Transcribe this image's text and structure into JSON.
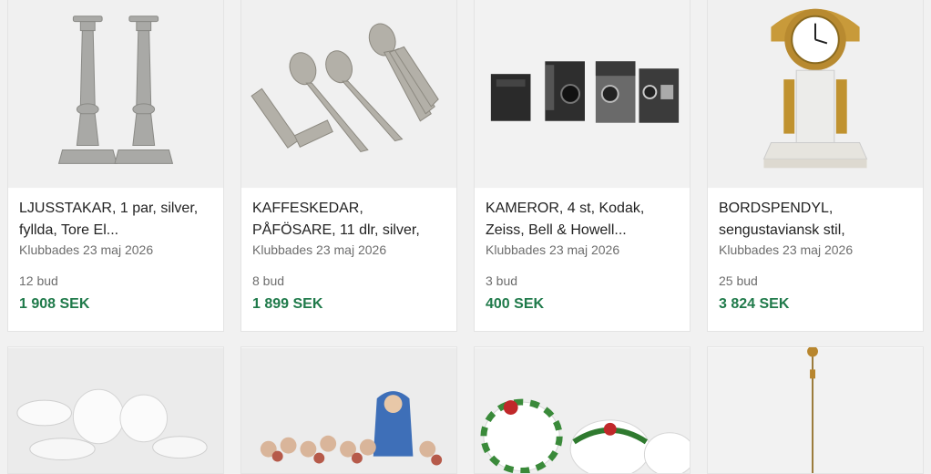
{
  "lots": [
    {
      "title_line1": "LJUSSTAKAR, 1 par, silver,",
      "title_line2": "fyllda, Tore El...",
      "sold_date": "Klubbades 23 maj 2026",
      "bids": "12 bud",
      "price": "1 908 SEK"
    },
    {
      "title_line1": "KAFFESKEDAR,",
      "title_line2": "PÅFÖSARE, 11 dlr, silver,",
      "sold_date": "Klubbades 23 maj 2026",
      "bids": "8 bud",
      "price": "1 899 SEK"
    },
    {
      "title_line1": "KAMEROR, 4 st, Kodak,",
      "title_line2": "Zeiss, Bell & Howell...",
      "sold_date": "Klubbades 23 maj 2026",
      "bids": "3 bud",
      "price": "400 SEK"
    },
    {
      "title_line1": "BORDSPENDYL,",
      "title_line2": "sengustaviansk stil,",
      "sold_date": "Klubbades 23 maj 2026",
      "bids": "25 bud",
      "price": "3 824 SEK"
    }
  ],
  "colors": {
    "price_green": "#1f7a4a",
    "title_text": "#222222",
    "meta_text": "#6d6d6d",
    "card_bg": "#ffffff",
    "page_bg": "#f1f1f1"
  }
}
